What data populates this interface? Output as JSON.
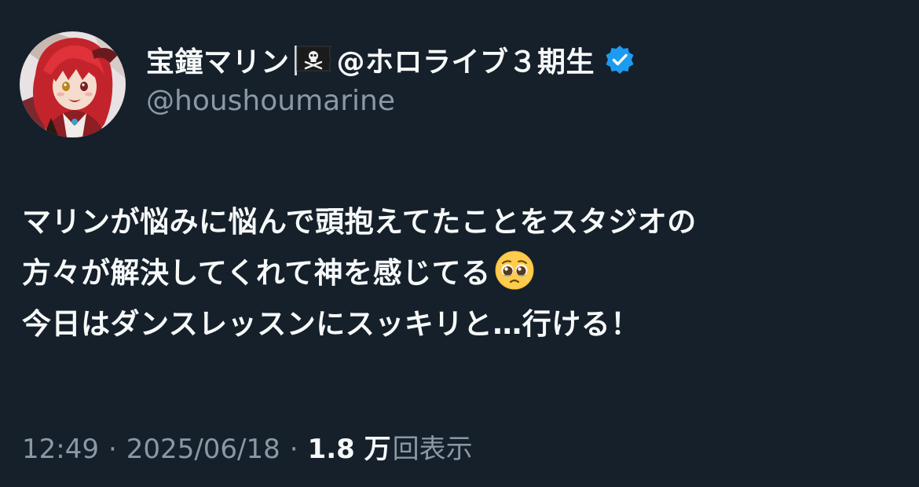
{
  "author": {
    "display_name": "宝鐘マリン",
    "flag_icon": "pirate-flag-icon",
    "affiliation": "@ホロライブ３期生",
    "verified_icon": "verified-badge-icon",
    "verified_color": "#1d9bf0",
    "handle": "@houshoumarine"
  },
  "tweet": {
    "lines": [
      "マリンが悩みに悩んで頭抱えてたことをスタジオの",
      "方々が解決してくれて神を感じてる",
      "今日はダンスレッスンにスッキリと…行ける！"
    ],
    "emoji_icon": "pleading-face-emoji"
  },
  "meta": {
    "time": "12:49",
    "separator": "·",
    "date": "2025/06/18",
    "views_count": "1.8 万",
    "views_label": "回表示"
  },
  "colors": {
    "background": "#15202b",
    "primary_text": "#f7f9f9",
    "secondary_text": "#8b98a5"
  }
}
